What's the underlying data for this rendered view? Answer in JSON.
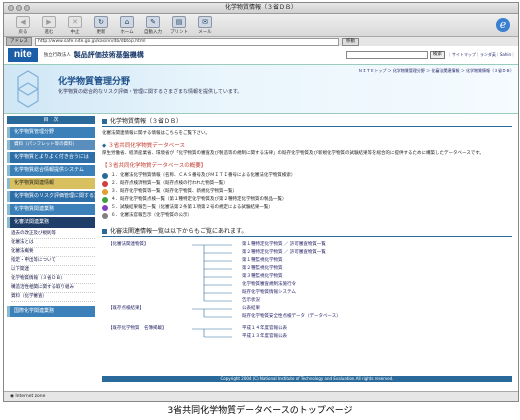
{
  "window": {
    "title": "化学物質情報（３省ＤＢ）"
  },
  "toolbar": {
    "buttons": [
      {
        "label": "戻る",
        "icon": "back-icon",
        "enabled": false
      },
      {
        "label": "進む",
        "icon": "forward-icon",
        "enabled": false
      },
      {
        "label": "中止",
        "icon": "stop-icon",
        "enabled": false
      },
      {
        "label": "更新",
        "icon": "refresh-icon",
        "enabled": true
      },
      {
        "label": "ホーム",
        "icon": "home-icon",
        "enabled": true
      },
      {
        "label": "自動入力",
        "icon": "autofill-icon",
        "enabled": true
      },
      {
        "label": "プリント",
        "icon": "print-icon",
        "enabled": true
      },
      {
        "label": "メール",
        "icon": "mail-icon",
        "enabled": true
      }
    ]
  },
  "address": {
    "label": "アドレス",
    "url": "http://www.safe.nite.go.jp/kasinn/db/dbtop.html",
    "go": "移動"
  },
  "header": {
    "logo": "nite",
    "org_small": "独立行政法人",
    "org": "製品評価技術基盤機構",
    "search_button": "検索",
    "links": "｜サイトマップ｜ランダ英｜Sahin｜"
  },
  "banner": {
    "breadcrumb": "ＮＩＴＥトップ ＞ 化学物質管理分野 ＞ 化審法関連情報 ＞ 化学物質情報（３省ＤＢ）",
    "title": "化学物質管理分野",
    "subtitle": "化学物質の総合的なリスク評価・管理に関するさまざまな情報を提供しています。"
  },
  "sidebar": {
    "heading": "目　次",
    "items": [
      {
        "label": "化学物質管理分野",
        "style": "alt"
      },
      {
        "label": "資料（パンフレット等の資料）",
        "style": "sub"
      },
      {
        "label": "化学物質とよりよく付き合うには",
        "style": ""
      },
      {
        "label": "化学物質総合情報提供システム",
        "style": "alt"
      },
      {
        "label": "化学物質関連情報",
        "style": "yellow"
      },
      {
        "label": "化学物質のリスク評価管理に関する業務",
        "style": ""
      },
      {
        "label": "化学物質関連業務",
        "style": "alt"
      },
      {
        "label": "化審法関連業務",
        "style": "dark"
      }
    ],
    "subs": [
      "過去の改正及び規則等",
      "化審法とは",
      "化審法概要",
      "指定・申出等について",
      "以下関連",
      "化学物質情報（３省ＤＢ）",
      "構造活性相関に関する取り組み",
      "資料（化学審査）"
    ],
    "bottom": "国際化学関連業務"
  },
  "main": {
    "heading": "化学物質情報（３省ＤＢ）",
    "intro": "化審法関連情報に関する情報はこちらをご覧下さい。",
    "sec1": "３省共同化学物質データベース",
    "desc": "厚生労働省、経済産業省、環境省が「化学物質の審査及び製造等の規制に関する法律」の既存化学物質及び新規化学物質の試験結果等を総合的に提供するために構築したデータベースです。",
    "sec2": "【３省共同化学物質データベースの概要】",
    "bullets": [
      {
        "text": "１．化審法化学物質情報（名称、ＣＡＳ番号及びＭＩＴＩ番号による化審法化学物質検索）",
        "color": "#2a6a9a"
      },
      {
        "text": "２．既存点検済物質一覧（既存点検の行われた物質一覧）",
        "color": "#d04040"
      },
      {
        "text": "３．既存化学物質等一覧（既存化学物質、新規化学物質一覧）",
        "color": "#e0a030"
      },
      {
        "text": "４．既存化学物質点検一覧（第１種特定化学物質及び第２種特定化学物質の製品一覧）",
        "color": "#40a040"
      },
      {
        "text": "５．試験結果報告一覧（化審法第２条第１項第２号の規定による試験結果一覧）",
        "color": "#8040c0"
      },
      {
        "text": "６．化審法官報告示（化学物質の公示）",
        "color": "#808080"
      }
    ],
    "tree_title": "化審法関連情報一覧は以下からもご覧にあれます。",
    "tree_left": [
      "【化審法関連物質】",
      "【既存点検結果】",
      "【既存化学物質　名簿掲載】"
    ],
    "tree_right": [
      "第１種特定化学物質 ／ 許可審査物質一覧",
      "第２種特定化学物質 ／ 許可審査物質一覧",
      "第１種監視化学物質",
      "第２種監視化学物質",
      "第３種監視化学物質",
      "化学物質審査規制法施行令",
      "既存化学物質情報システム",
      "告示状況",
      "公表結果",
      "既存化学物質安全性点検データ（データベース）",
      "平成１４年度官報公表",
      "平成１３年度官報公表"
    ]
  },
  "footer": "Copyright 2004 (C) National Institute of Technology and Evaluation.All rights reserved.",
  "status": "Internet zone",
  "caption": "3省共同化学物質データベースのトップページ"
}
